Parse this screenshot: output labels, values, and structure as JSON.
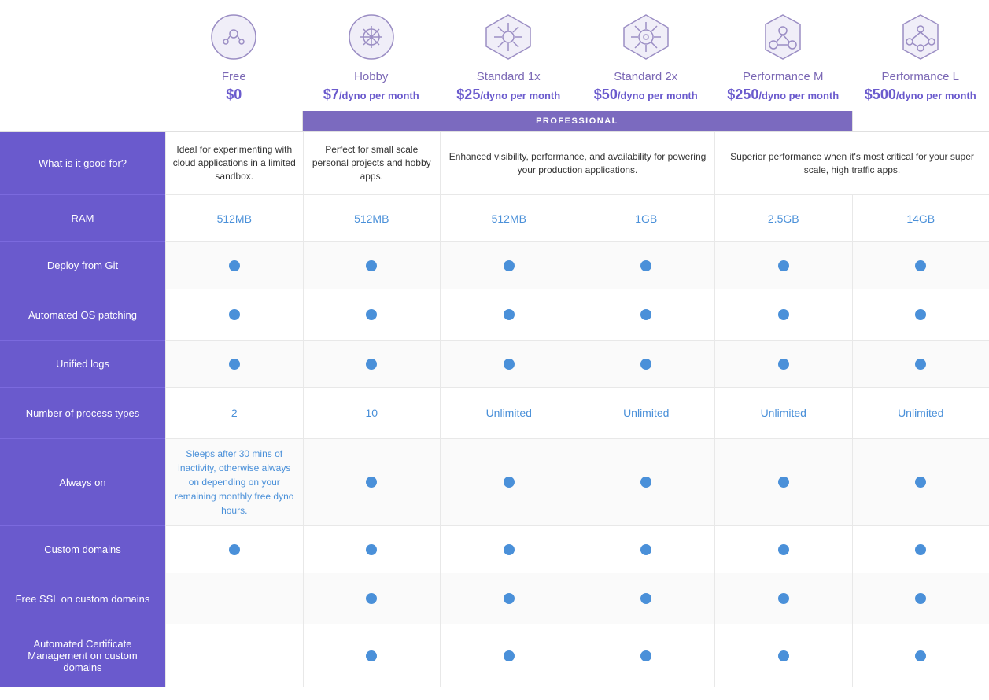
{
  "plans": [
    {
      "id": "free",
      "name": "Free",
      "price_display": "$0",
      "price_suffix": "",
      "ram": "512MB",
      "process_types": "2",
      "always_on": "special",
      "always_on_text": "Sleeps after 30 mins of inactivity, otherwise always on depending on your remaining monthly free dyno hours.",
      "custom_domains": true,
      "ssl": false,
      "cert_mgmt": false
    },
    {
      "id": "hobby",
      "name": "Hobby",
      "price_display": "$7",
      "price_suffix": "/dyno per month",
      "ram": "512MB",
      "process_types": "10",
      "always_on": true,
      "custom_domains": true,
      "ssl": true,
      "cert_mgmt": true
    },
    {
      "id": "standard1x",
      "name": "Standard 1x",
      "price_display": "$25",
      "price_suffix": "/dyno per month",
      "ram": "512MB",
      "process_types": "Unlimited",
      "always_on": true,
      "custom_domains": true,
      "ssl": true,
      "cert_mgmt": true,
      "professional": true
    },
    {
      "id": "standard2x",
      "name": "Standard 2x",
      "price_display": "$50",
      "price_suffix": "/dyno per month",
      "ram": "1GB",
      "process_types": "Unlimited",
      "always_on": true,
      "custom_domains": true,
      "ssl": true,
      "cert_mgmt": true,
      "professional": true
    },
    {
      "id": "performance_m",
      "name": "Performance M",
      "price_display": "$250",
      "price_suffix": "/dyno per month",
      "ram": "2.5GB",
      "process_types": "Unlimited",
      "always_on": true,
      "custom_domains": true,
      "ssl": true,
      "cert_mgmt": true,
      "professional": true
    },
    {
      "id": "performance_l",
      "name": "Performance L",
      "price_display": "$500",
      "price_suffix": "/dyno per month",
      "ram": "14GB",
      "process_types": "Unlimited",
      "always_on": true,
      "custom_domains": true,
      "ssl": true,
      "cert_mgmt": true,
      "professional": true
    }
  ],
  "features": [
    {
      "id": "good_for",
      "label": "What is it good for?"
    },
    {
      "id": "ram",
      "label": "RAM"
    },
    {
      "id": "deploy_git",
      "label": "Deploy from Git"
    },
    {
      "id": "automated_os",
      "label": "Automated OS patching"
    },
    {
      "id": "unified_logs",
      "label": "Unified logs"
    },
    {
      "id": "process_types",
      "label": "Number of process types"
    },
    {
      "id": "always_on",
      "label": "Always on"
    },
    {
      "id": "custom_domains",
      "label": "Custom domains"
    },
    {
      "id": "free_ssl",
      "label": "Free SSL on custom domains"
    },
    {
      "id": "cert_mgmt",
      "label": "Automated Certificate Management on custom domains"
    }
  ],
  "good_for": {
    "free": "Ideal for experimenting with cloud applications in a limited sandbox.",
    "hobby": "Perfect for small scale personal projects and hobby apps.",
    "professional": "Enhanced visibility, performance, and availability for powering your production applications.",
    "performance": "Superior performance when it's most critical for your super scale, high traffic apps."
  },
  "professional_label": "PROFESSIONAL"
}
